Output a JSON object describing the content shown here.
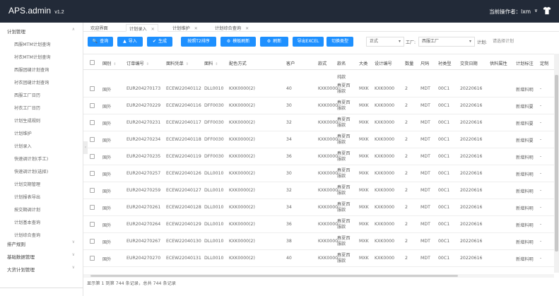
{
  "app": {
    "title": "APS.admin",
    "version": "v1.2",
    "operator_label": "当前操作者：lxm",
    "caret": "∨"
  },
  "sidebar": {
    "groups": [
      {
        "label": "计划管理",
        "expanded": true,
        "items": [
          "西服MTM计划查询",
          "衬衣MTM计划查询",
          "西服团缝计划查询",
          "衬衣团缝计划查询",
          "西服工厂日历",
          "衬衣工厂日历",
          "计划生成规则",
          "计划维护",
          "计划录入",
          "快速调计划(手工)",
          "快速调计划(选择)",
          "计划交期管理",
          "计划报表导出",
          "按交期调计划",
          "计划基本查询",
          "计划综合查询"
        ]
      },
      {
        "label": "排产规则",
        "expanded": false
      },
      {
        "label": "基础数据管理",
        "expanded": false
      },
      {
        "label": "大货计划管理",
        "expanded": false
      }
    ]
  },
  "tabs": [
    {
      "label": "欢迎界面",
      "closable": false
    },
    {
      "label": "计划录入",
      "closable": true,
      "active": true
    },
    {
      "label": "计划维护",
      "closable": true
    },
    {
      "label": "计划综合查询",
      "closable": true
    }
  ],
  "toolbar": {
    "buttons": [
      {
        "label": "查询",
        "icon": "search-icon"
      },
      {
        "label": "导入",
        "icon": "upload-icon"
      },
      {
        "label": "生成",
        "icon": "check-icon"
      },
      {
        "label": "按照T2排序",
        "icon": ""
      },
      {
        "label": "模板刷新",
        "icon": "gear-icon"
      },
      {
        "label": "刷新",
        "icon": "gear-icon"
      },
      {
        "label": "导出EXCEL",
        "icon": ""
      },
      {
        "label": "切换类型",
        "icon": ""
      }
    ],
    "type_select": "正式",
    "factory_label": "工厂:",
    "factory_select": "西服工厂",
    "plan_label": "计划:",
    "plan_placeholder": "请选择计划"
  },
  "table": {
    "columns": [
      "国别",
      "订单编号",
      "面料凭单",
      "面料",
      "配色方式",
      "客户",
      "款式",
      "款名",
      "大类",
      "设计编号",
      "数量",
      "尺码",
      "衬类型",
      "交货日期",
      "供料属性",
      "计划标注",
      "定制"
    ],
    "rows": [
      [
        "国外",
        "EUR204270173",
        "ECEW22040112",
        "DLL0010",
        "KXK0000(2)",
        "40",
        "KXK0000",
        "春夏西服款",
        "MXK",
        "KXK0000",
        "2",
        "MDT",
        "00C1",
        "20220616",
        "",
        "新增料明",
        "-"
      ],
      [
        "国外",
        "EUR204270229",
        "ECEW22040116",
        "DFF0030",
        "KXK0000(2)",
        "30",
        "KXK0000",
        "春夏西服款",
        "MXK",
        "KXK0000",
        "2",
        "MDT",
        "00C1",
        "20220616",
        "",
        "新增料要",
        "-"
      ],
      [
        "国外",
        "EUR204270231",
        "ECEW22040117",
        "DFF0030",
        "KXK0000(2)",
        "32",
        "KXK0000",
        "春夏西服款",
        "MXK",
        "KXK0000",
        "2",
        "MDT",
        "00C1",
        "20220616",
        "",
        "新增料要",
        "-"
      ],
      [
        "国外",
        "EUR204270234",
        "ECEW22040118",
        "DFF0030",
        "KXK0000(2)",
        "34",
        "KXK0000",
        "春夏西服款",
        "MXK",
        "KXK0000",
        "2",
        "MDT",
        "00C1",
        "20220616",
        "",
        "新增料要",
        "-"
      ],
      [
        "国外",
        "EUR204270235",
        "ECEW22040119",
        "DFF0030",
        "KXK0000(2)",
        "36",
        "KXK0000",
        "春夏西服款",
        "MXK",
        "KXK0000",
        "2",
        "MDT",
        "00C1",
        "20220616",
        "",
        "新增料明",
        "-"
      ],
      [
        "国外",
        "EUR204270257",
        "ECEW22040126",
        "DLL0010",
        "KXK0000(2)",
        "30",
        "KXK0000",
        "春夏西服款",
        "MXK",
        "KXK0000",
        "2",
        "MDT",
        "00C1",
        "20220616",
        "",
        "新增料明",
        "-"
      ],
      [
        "国外",
        "EUR204270259",
        "ECEW22040127",
        "DLL0010",
        "KXK0000(2)",
        "32",
        "KXK0000",
        "春夏西服款",
        "MXK",
        "KXK0000",
        "2",
        "MDT",
        "00C1",
        "20220616",
        "",
        "新增料明",
        "-"
      ],
      [
        "国外",
        "EUR204270261",
        "ECEW22040128",
        "DLL0010",
        "KXK0000(2)",
        "34",
        "KXK0000",
        "春夏西服款",
        "MXK",
        "KXK0000",
        "2",
        "MDT",
        "00C1",
        "20220616",
        "",
        "新增料明",
        "-"
      ],
      [
        "国外",
        "EUR204270264",
        "ECEW22040129",
        "DLL0010",
        "KXK0000(2)",
        "36",
        "KXK0000",
        "春夏西服款",
        "MXK",
        "KXK0000",
        "2",
        "MDT",
        "00C1",
        "20220616",
        "",
        "新增料明",
        "-"
      ],
      [
        "国外",
        "EUR204270267",
        "ECEW22040130",
        "DLL0010",
        "KXK0000(2)",
        "38",
        "KXK0000",
        "春夏西服款",
        "MXK",
        "KXK0000",
        "2",
        "MDT",
        "00C1",
        "20220616",
        "",
        "新增料明",
        "-"
      ],
      [
        "国外",
        "EUR204270270",
        "ECEW22040131",
        "DLL0010",
        "KXK0000(2)",
        "40",
        "KXK0000",
        "春夏西服款",
        "MXK",
        "KXK0000",
        "2",
        "MDT",
        "00C1",
        "20220616",
        "",
        "新增料明",
        "-"
      ]
    ],
    "partial_top_cell": "纯款"
  },
  "footer": {
    "summary": "显示第 1 到第 744 条记录，总共 744 条记录"
  },
  "colors": {
    "topbar": "#222a38",
    "button": "#1e90ff"
  }
}
